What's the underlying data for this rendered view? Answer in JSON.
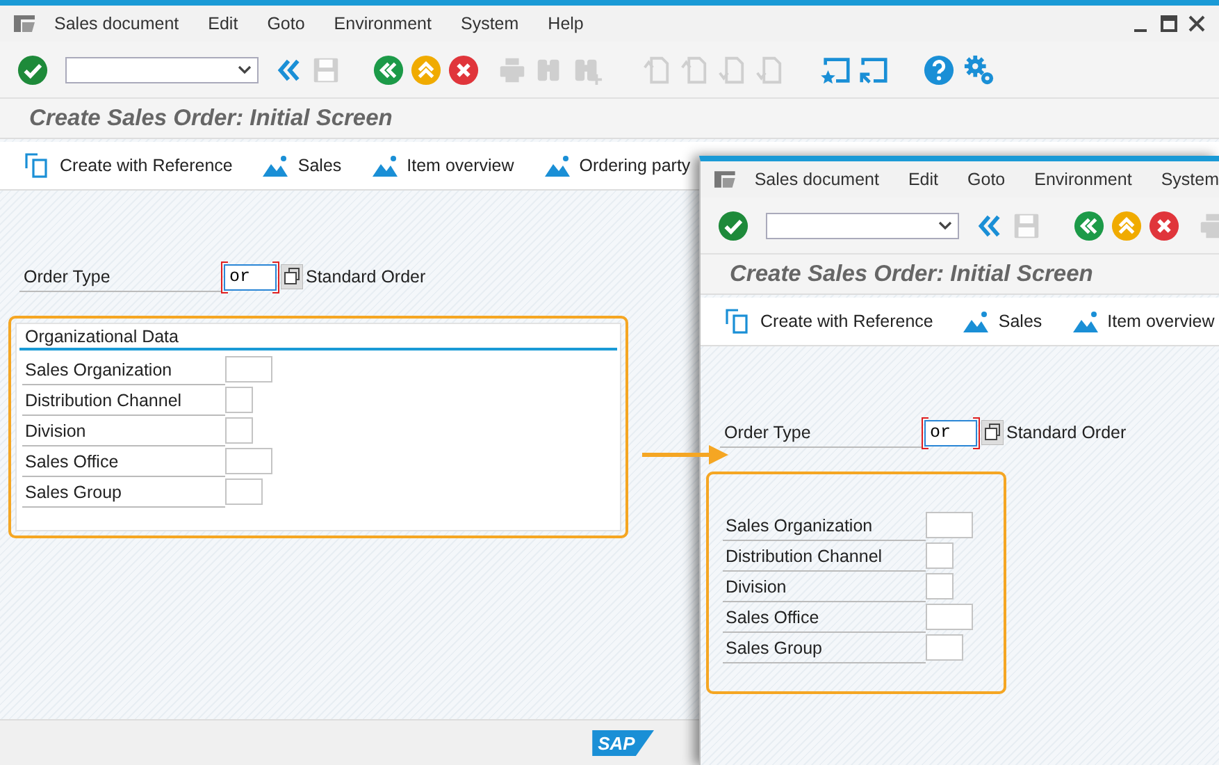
{
  "windows": [
    {
      "menu": [
        "Sales document",
        "Edit",
        "Goto",
        "Environment",
        "System",
        "Help"
      ],
      "window_controls": true,
      "toolbar": [
        {
          "kind": "enter",
          "disabled": false
        },
        {
          "kind": "command_field",
          "disabled": false
        },
        {
          "kind": "double_back",
          "disabled": false
        },
        {
          "kind": "save",
          "disabled": true
        },
        {
          "kind": "back",
          "disabled": false
        },
        {
          "kind": "exit",
          "disabled": false
        },
        {
          "kind": "cancel",
          "disabled": false
        },
        {
          "kind": "print",
          "disabled": true
        },
        {
          "kind": "find",
          "disabled": true
        },
        {
          "kind": "find_next",
          "disabled": true
        },
        {
          "kind": "first_page",
          "disabled": true
        },
        {
          "kind": "prev_page",
          "disabled": true
        },
        {
          "kind": "next_page",
          "disabled": true
        },
        {
          "kind": "last_page",
          "disabled": true
        },
        {
          "kind": "new_session",
          "disabled": false
        },
        {
          "kind": "shortcut",
          "disabled": false
        },
        {
          "kind": "help",
          "disabled": false
        },
        {
          "kind": "settings",
          "disabled": false
        }
      ],
      "title": "Create Sales Order: Initial Screen",
      "app_toolbar": [
        {
          "kind": "reference",
          "label": "Create with Reference"
        },
        {
          "kind": "mountain",
          "label": "Sales"
        },
        {
          "kind": "mountain",
          "label": "Item overview"
        },
        {
          "kind": "mountain",
          "label": "Ordering party"
        }
      ],
      "order_type": {
        "label": "Order Type",
        "value": "or",
        "required": true,
        "description": "Standard Order"
      },
      "org_data": {
        "highlighted": true,
        "title": "Organizational Data",
        "fields": [
          "Sales Organization",
          "Distribution Channel",
          "Division",
          "Sales Office",
          "Sales Group"
        ]
      },
      "status_bar": {
        "logo": "SAP"
      }
    },
    {
      "menu": [
        "Sales document",
        "Edit",
        "Goto",
        "Environment",
        "System"
      ],
      "window_controls": false,
      "toolbar": [
        {
          "kind": "enter",
          "disabled": false
        },
        {
          "kind": "command_field",
          "disabled": false
        },
        {
          "kind": "double_back",
          "disabled": false
        },
        {
          "kind": "save",
          "disabled": true
        },
        {
          "kind": "back",
          "disabled": false
        },
        {
          "kind": "exit",
          "disabled": false
        },
        {
          "kind": "cancel",
          "disabled": false
        },
        {
          "kind": "print",
          "disabled": true
        }
      ],
      "title": "Create Sales Order: Initial Screen",
      "app_toolbar": [
        {
          "kind": "reference",
          "label": "Create with Reference"
        },
        {
          "kind": "mountain",
          "label": "Sales"
        },
        {
          "kind": "mountain",
          "label": "Item overview"
        }
      ],
      "order_type": {
        "label": "Order Type",
        "value": "or",
        "required": true,
        "description": "Standard Order"
      },
      "org_data": {
        "highlighted": true,
        "fields": [
          "Sales Organization",
          "Distribution Channel",
          "Division",
          "Sales Office",
          "Sales Group"
        ]
      }
    }
  ],
  "arrow": true
}
